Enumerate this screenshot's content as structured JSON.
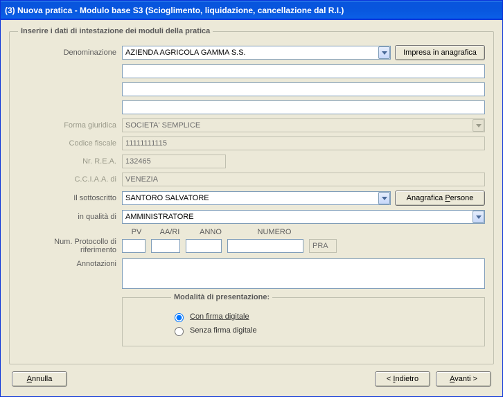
{
  "window": {
    "title": "(3) Nuova pratica - Modulo base S3 (Scioglimento, liquidazione, cancellazione dal R.I.)"
  },
  "group": {
    "legend": "Inserire i dati di intestazione dei moduli della pratica"
  },
  "labels": {
    "denominazione": "Denominazione",
    "forma_giuridica": "Forma giuridica",
    "codice_fiscale": "Codice fiscale",
    "nr_rea": "Nr. R.E.A.",
    "cciaa": "C.C.I.A.A. di",
    "sottoscritto": "Il sottoscritto",
    "qualita": "in qualità di",
    "protocollo": "Num. Protocollo di riferimento",
    "annotazioni": "Annotazioni",
    "modal_legend": "Modalità di presentazione:",
    "radio_con": "Con firma digitale",
    "radio_senza": "Senza firma digitale",
    "proto_pv": "PV",
    "proto_aari": "AA/RI",
    "proto_anno": "ANNO",
    "proto_numero": "NUMERO"
  },
  "values": {
    "denominazione": "AZIENDA AGRICOLA GAMMA S.S.",
    "denom_extra1": "",
    "denom_extra2": "",
    "denom_extra3": "",
    "forma_giuridica": "SOCIETA' SEMPLICE",
    "codice_fiscale": "11111111115",
    "nr_rea": "132465",
    "cciaa": "VENEZIA",
    "sottoscritto": "SANTORO SALVATORE",
    "qualita": "AMMINISTRATORE",
    "proto_pv": "",
    "proto_aari": "",
    "proto_anno": "",
    "proto_numero": "",
    "proto_suffix": "PRA",
    "annotazioni": ""
  },
  "buttons": {
    "impresa": "Impresa in anagrafica",
    "anagrafica_persone_prefix": "Anagrafica ",
    "anagrafica_persone_u": "P",
    "anagrafica_persone_suffix": "ersone",
    "annulla_u": "A",
    "annulla_rest": "nnulla",
    "indietro_prefix": "< ",
    "indietro_u": "I",
    "indietro_rest": "ndietro",
    "avanti_u": "A",
    "avanti_rest": "vanti >"
  }
}
